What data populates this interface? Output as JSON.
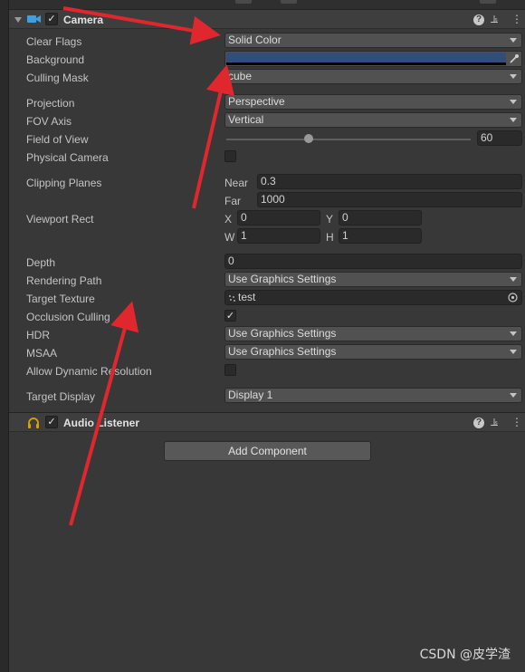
{
  "camera": {
    "title": "Camera",
    "enabled_mark": "✓",
    "header_buttons": {
      "help": "?",
      "preset": "⫡",
      "menu": "⋮"
    },
    "fields": {
      "clear_flags": {
        "label": "Clear Flags",
        "value": "Solid Color"
      },
      "background": {
        "label": "Background",
        "color": "#314d79"
      },
      "culling_mask": {
        "label": "Culling Mask",
        "value": "cube"
      },
      "projection": {
        "label": "Projection",
        "value": "Perspective"
      },
      "fov_axis": {
        "label": "FOV Axis",
        "value": "Vertical"
      },
      "field_of_view": {
        "label": "Field of View",
        "value": "60",
        "slider_fraction": 0.33
      },
      "physical_camera": {
        "label": "Physical Camera",
        "checked": false
      },
      "clipping_planes": {
        "label": "Clipping Planes",
        "near_label": "Near",
        "near": "0.3",
        "far_label": "Far",
        "far": "1000"
      },
      "viewport_rect": {
        "label": "Viewport Rect",
        "x_label": "X",
        "x": "0",
        "y_label": "Y",
        "y": "0",
        "w_label": "W",
        "w": "1",
        "h_label": "H",
        "h": "1"
      },
      "depth": {
        "label": "Depth",
        "value": "0"
      },
      "rendering_path": {
        "label": "Rendering Path",
        "value": "Use Graphics Settings"
      },
      "target_texture": {
        "label": "Target Texture",
        "value": "test"
      },
      "occlusion_culling": {
        "label": "Occlusion Culling",
        "checked": true,
        "mark": "✓"
      },
      "hdr": {
        "label": "HDR",
        "value": "Use Graphics Settings"
      },
      "msaa": {
        "label": "MSAA",
        "value": "Use Graphics Settings"
      },
      "allow_dynamic_resolution": {
        "label": "Allow Dynamic Resolution",
        "checked": false
      },
      "target_display": {
        "label": "Target Display",
        "value": "Display 1"
      }
    }
  },
  "audio_listener": {
    "title": "Audio Listener",
    "enabled_mark": "✓",
    "header_buttons": {
      "help": "?",
      "preset": "⫡",
      "menu": "⋮"
    }
  },
  "add_component_label": "Add Component",
  "watermark": "CSDN @皮学渣",
  "icons": [
    "foldout-triangle",
    "camera-icon",
    "headphones-icon",
    "help-icon",
    "preset-icon",
    "kebab-menu-icon",
    "eyedropper-icon",
    "object-picker-icon",
    "render-texture-icon"
  ],
  "colors": {
    "annotation_arrow": "#e0272e",
    "background_swatch": "#314d79"
  }
}
